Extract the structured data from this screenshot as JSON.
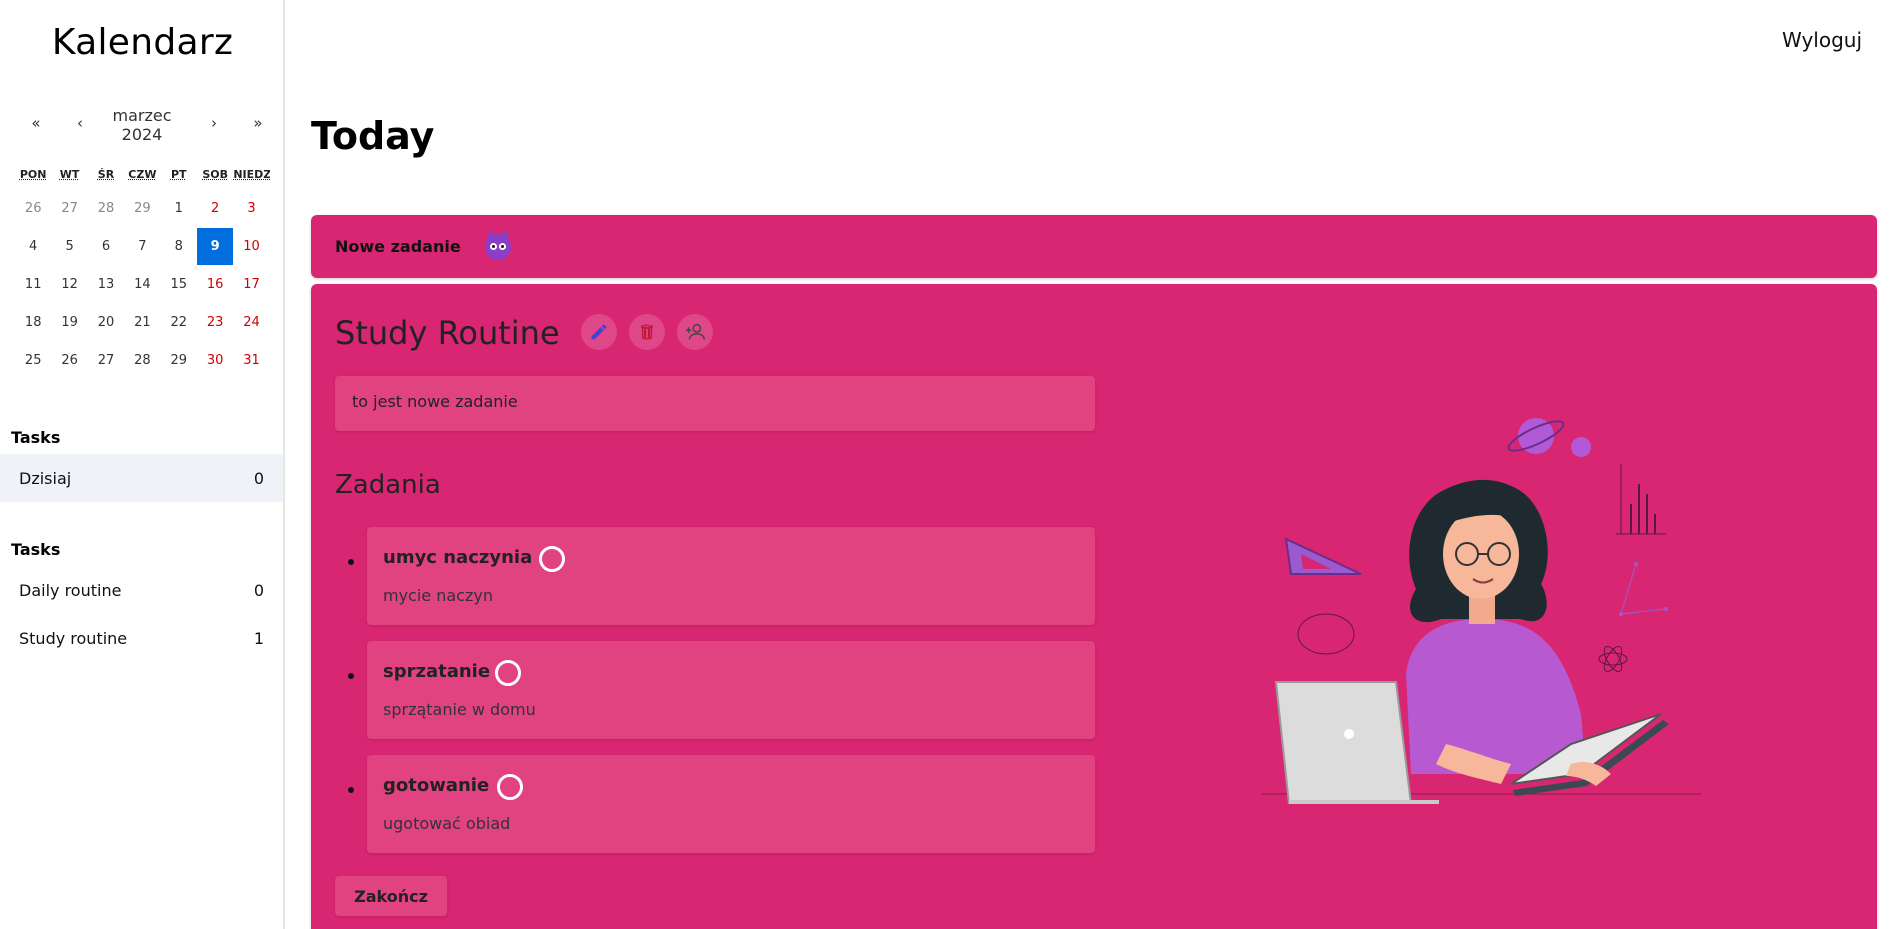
{
  "sidebar": {
    "brand": "Kalendarz",
    "calendar": {
      "prev_year": "«",
      "prev_month": "‹",
      "month_label": "marzec\n2024",
      "month": "marzec",
      "year": "2024",
      "next_month": "›",
      "next_year": "»",
      "weekdays": [
        "PON",
        "WT",
        "ŚR",
        "CZW",
        "PT",
        "SOB",
        "NIEDZ"
      ],
      "weeks": [
        [
          "26",
          "27",
          "28",
          "29",
          "1",
          "2",
          "3"
        ],
        [
          "4",
          "5",
          "6",
          "7",
          "8",
          "9",
          "10"
        ],
        [
          "11",
          "12",
          "13",
          "14",
          "15",
          "16",
          "17"
        ],
        [
          "18",
          "19",
          "20",
          "21",
          "22",
          "23",
          "24"
        ],
        [
          "25",
          "26",
          "27",
          "28",
          "29",
          "30",
          "31"
        ]
      ],
      "selected_day": "9"
    },
    "groups": [
      {
        "title": "Tasks",
        "items": [
          {
            "label": "Dzisiaj",
            "count": "0"
          }
        ]
      },
      {
        "title": "Tasks",
        "items": [
          {
            "label": "Daily routine",
            "count": "0"
          },
          {
            "label": "Study routine",
            "count": "1"
          }
        ]
      }
    ]
  },
  "header": {
    "logout": "Wyloguj",
    "page_title": "Today"
  },
  "new_task": {
    "label": "Nowe zadanie"
  },
  "routine": {
    "title": "Study Routine",
    "description": "to jest nowe zadanie",
    "section_title": "Zadania",
    "tasks": [
      {
        "name": "umyc naczynia",
        "description": "mycie naczyn"
      },
      {
        "name": "sprzatanie",
        "description": "sprzątanie w domu"
      },
      {
        "name": "gotowanie",
        "description": "ugotować obiad"
      }
    ],
    "finish_label": "Zakończ"
  },
  "colors": {
    "accent": "#d92672",
    "card": "#e0437f",
    "selected_day": "#006edc",
    "weekend": "#d10000",
    "edit_icon": "#4b3fd6",
    "delete_icon": "#c0183a"
  }
}
